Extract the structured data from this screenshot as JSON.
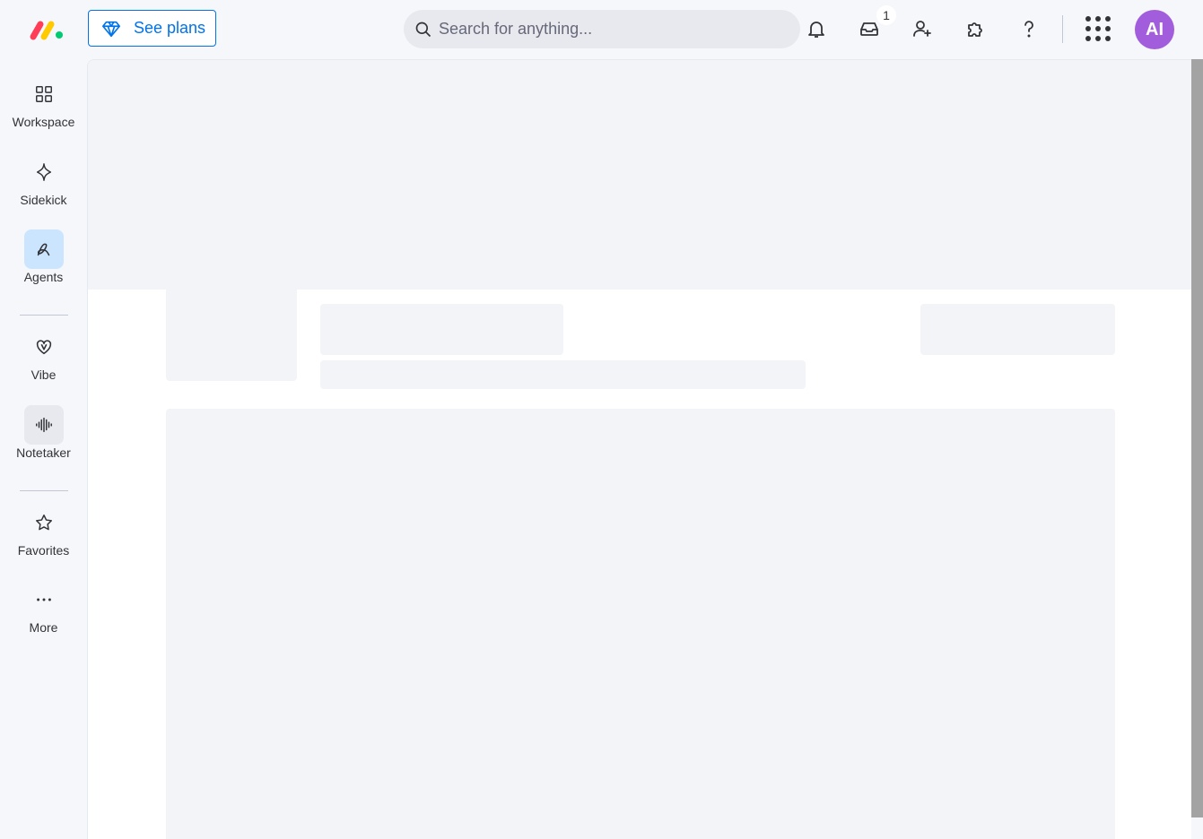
{
  "header": {
    "logo_icon": "monday-logo-icon",
    "see_plans_label": "See plans",
    "search_placeholder": "Search for anything...",
    "inbox_badge": "1",
    "avatar_initials": "AI",
    "accent_color": "#0073ea",
    "avatar_color": "#a25ddc"
  },
  "sidebar": {
    "items": [
      {
        "label": "Workspace",
        "icon": "grid-icon"
      },
      {
        "label": "Sidekick",
        "icon": "sparkle-icon"
      },
      {
        "label": "Agents",
        "icon": "agents-icon"
      },
      {
        "label": "Vibe",
        "icon": "heart-icon"
      },
      {
        "label": "Notetaker",
        "icon": "waveform-icon"
      },
      {
        "label": "Favorites",
        "icon": "star-icon"
      },
      {
        "label": "More",
        "icon": "ellipsis-icon"
      }
    ]
  }
}
